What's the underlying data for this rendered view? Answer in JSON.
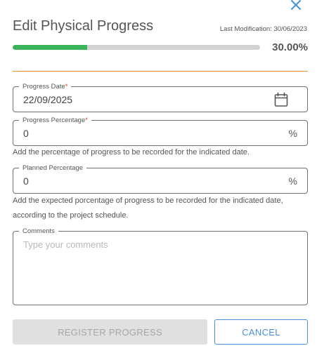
{
  "dialog": {
    "title": "Edit Physical Progress",
    "last_modification": "Last Modification: 30/06/2023",
    "progress": 0.3,
    "progress_label": "30.00%",
    "close_icon": "close-icon"
  },
  "colors": {
    "progress_fill": "#3bb55c",
    "divider": "#e28b3a",
    "accent": "#4a90d9",
    "required": "#e0362b"
  },
  "form": {
    "progress_date": {
      "label": "Progress Date",
      "required_mark": "*",
      "value": "22/09/2025",
      "icon": "calendar-icon"
    },
    "progress_percentage": {
      "label": "Progress Percentage",
      "required_mark": "*",
      "value": "0",
      "suffix": "%",
      "help": "Add the percentage of progress to be recorded for the indicated date."
    },
    "planned_percentage": {
      "label": "Planned Percentage",
      "value": "0",
      "suffix": "%",
      "help": "Add the expected porcentage of progress to be recorded for the indicated date, according to the project schedule."
    },
    "comments": {
      "label": "Comments",
      "placeholder": "Type your comments"
    }
  },
  "buttons": {
    "register": "REGISTER PROGRESS",
    "cancel": "CANCEL"
  }
}
